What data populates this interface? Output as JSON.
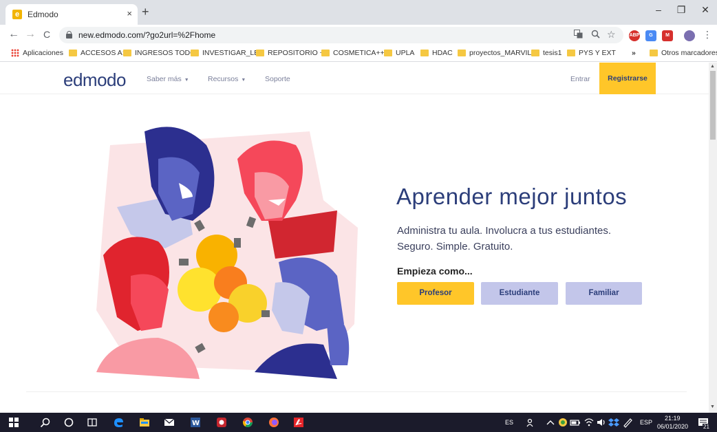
{
  "browser": {
    "tab_title": "Edmodo",
    "tab_favicon_letter": "e",
    "tab_close": "×",
    "new_tab": "+",
    "window_controls": [
      "–",
      "❐",
      "✕"
    ],
    "url": "new.edmodo.com/?go2url=%2Fhome",
    "nav": {
      "back": "←",
      "forward": "→",
      "reload": "C"
    },
    "omnibox_icons": [
      "translate-icon",
      "zoom-icon",
      "star-icon"
    ],
    "extensions": [
      {
        "name": "abp-extension-icon",
        "label": "ABP",
        "color": "#d6302d"
      },
      {
        "name": "translate-extension-icon",
        "label": "G",
        "color": "#4a8af4"
      },
      {
        "name": "red-extension-icon",
        "label": "M",
        "color": "#d6302d"
      },
      {
        "name": "profile-avatar-icon",
        "label": "",
        "color": "#7b6fb0"
      }
    ],
    "menu": "⋮"
  },
  "bookmarks": {
    "apps": "Aplicaciones",
    "items": [
      "ACCESOS A:",
      "INGRESOS TODO",
      "INVESTIGAR_LB",
      "REPOSITORIO +",
      "COSMETICA++",
      "UPLA",
      "HDAC",
      "proyectos_MARVIL",
      "tesis1",
      "PYS Y EXT"
    ],
    "overflow": "»",
    "other": "Otros marcadores"
  },
  "site": {
    "logo": "edmodo",
    "nav": [
      {
        "label": "Saber más",
        "caret": "▼"
      },
      {
        "label": "Recursos",
        "caret": "▼"
      },
      {
        "label": "Soporte",
        "caret": ""
      }
    ],
    "login": "Entrar",
    "signup": "Registrarse"
  },
  "hero": {
    "title": "Aprender mejor juntos",
    "subtitle_line1": "Administra tu aula. Involucra a tus estudiantes.",
    "subtitle_line2": "Seguro. Simple. Gratuito.",
    "start_label": "Empieza como...",
    "roles": [
      {
        "label": "Profesor",
        "color": "#ffc629"
      },
      {
        "label": "Estudiante",
        "color": "#c3c6ea"
      },
      {
        "label": "Familiar",
        "color": "#c3c6ea"
      }
    ]
  },
  "taskbar": {
    "lang": "ES",
    "keyboard": "ESP",
    "time": "21:19",
    "date": "06/01/2020",
    "notifications": "21"
  },
  "colors": {
    "brand_navy": "#2c3e7a",
    "brand_yellow": "#ffc629",
    "lavender": "#c3c6ea"
  }
}
